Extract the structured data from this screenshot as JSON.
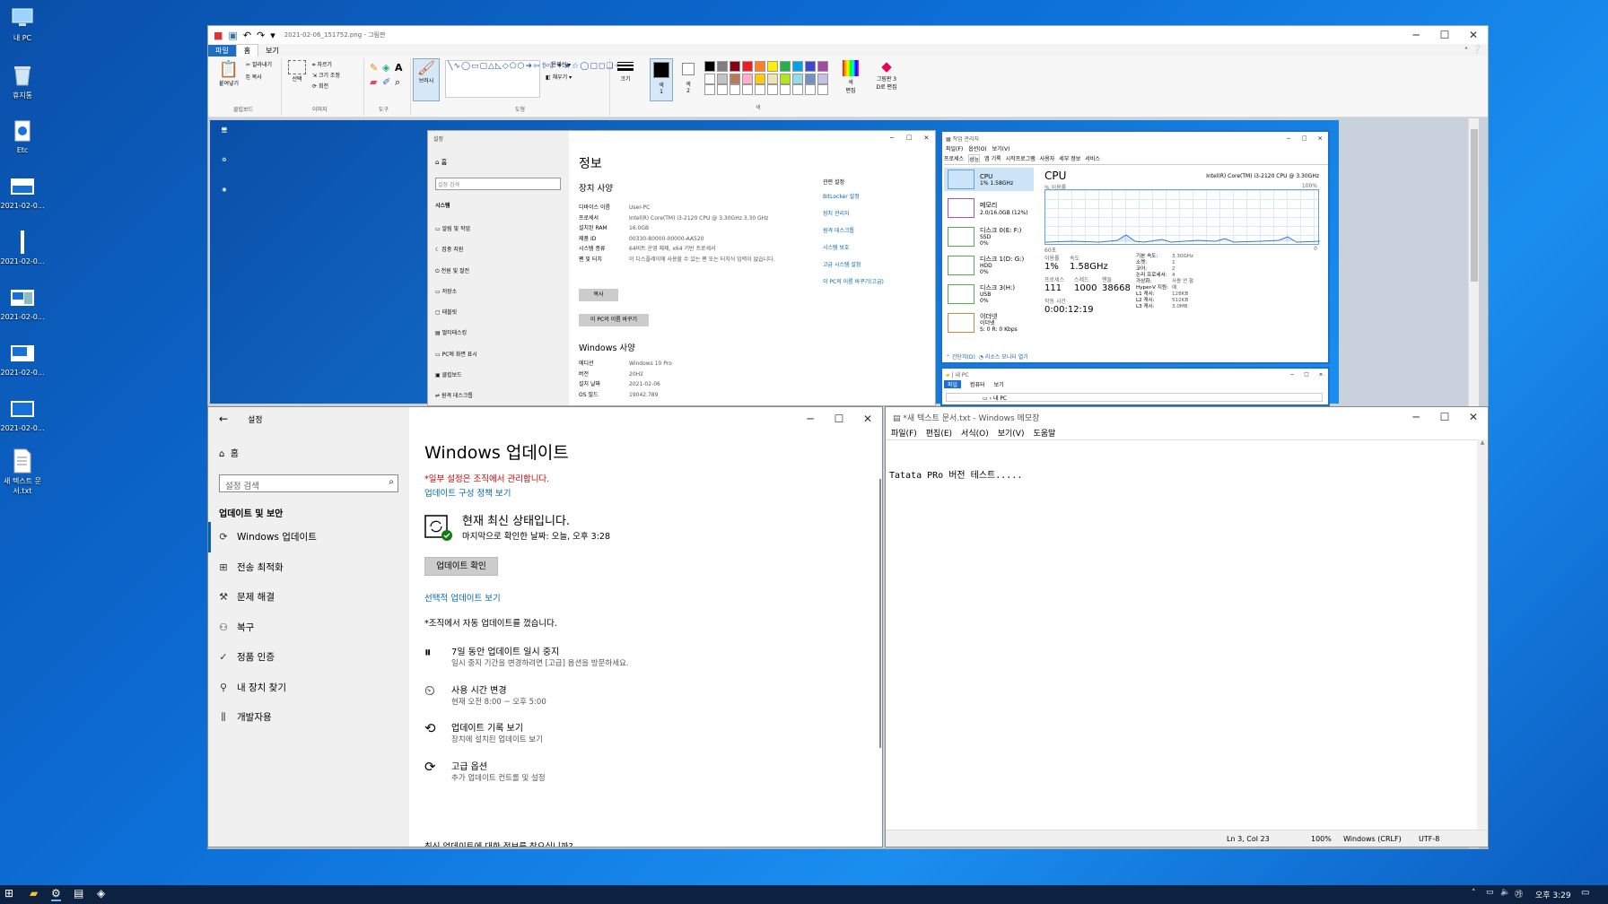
{
  "desktop": {
    "icons": [
      {
        "label": "내 PC",
        "icon": "computer-icon"
      },
      {
        "label": "휴지통",
        "icon": "recycle-bin-icon"
      },
      {
        "label": "Etc",
        "icon": "etc-icon"
      },
      {
        "label": "2021-02-0...",
        "icon": "image-file-icon"
      },
      {
        "label": "2021-02-0...",
        "icon": "image-file-icon"
      },
      {
        "label": "2021-02-0...",
        "icon": "image-file-icon"
      },
      {
        "label": "2021-02-0...",
        "icon": "image-file-icon"
      },
      {
        "label": "2021-02-0...",
        "icon": "image-file-icon"
      },
      {
        "label": "새 텍스트 문서.txt",
        "icon": "text-file-icon"
      }
    ]
  },
  "paint": {
    "title": "2021-02-06_151752.png - 그림판",
    "tabs": [
      "파일",
      "홈",
      "보기"
    ],
    "clipboard": {
      "paste": "붙여넣기",
      "cut": "잘라내기",
      "copy": "복사",
      "group": "클립보드"
    },
    "image": {
      "select": "선택",
      "crop": "자르기",
      "resize": "크기 조정",
      "rotate": "회전",
      "group": "이미지"
    },
    "tools": {
      "group": "도구",
      "brush": "브러시"
    },
    "shapes": {
      "outline": "윤곽선",
      "fill": "채우기",
      "group": "도형"
    },
    "size": "크기",
    "color1": "색\n1",
    "color2": "색\n2",
    "color_edit": "색\n편집",
    "paint3d": "그림판 3\nD로 편집",
    "colors_group": "색",
    "palette": [
      "#000000",
      "#7f7f7f",
      "#880015",
      "#ed1c24",
      "#ff7f27",
      "#fff200",
      "#22b14c",
      "#00a2e8",
      "#3f48cc",
      "#a349a4",
      "#ffffff",
      "#c3c3c3",
      "#b97a57",
      "#ffaec9",
      "#ffc90e",
      "#efe4b0",
      "#b5e61d",
      "#99d9ea",
      "#7092be",
      "#c8bfe7"
    ]
  },
  "inner_settings": {
    "title": "설정",
    "home": "홈",
    "search_placeholder": "설정 검색",
    "section": "시스템",
    "nav": [
      "알림 및 작업",
      "집중 지원",
      "전원 및 절전",
      "저장소",
      "태블릿",
      "멀티태스킹",
      "PC에 화면 표시",
      "클립보드",
      "원격 데스크톱"
    ],
    "page_title": "정보",
    "device_spec": "장치 사양",
    "rows": [
      {
        "k": "디바이스 이름",
        "v": "User-PC"
      },
      {
        "k": "프로세서",
        "v": "Intel(R) Core(TM) i3-2120 CPU @ 3.30GHz   3.30 GHz"
      },
      {
        "k": "설치된 RAM",
        "v": "16.0GB"
      },
      {
        "k": "제품 ID",
        "v": "00330-80000-00000-AA520"
      },
      {
        "k": "시스템 종류",
        "v": "64비트 운영 체제, x64 기반 프로세서"
      },
      {
        "k": "펜 및 터치",
        "v": "이 디스플레이에 사용할 수 있는 펜 또는 터치식 입력이 없습니다."
      }
    ],
    "copy_btn": "복사",
    "rename_btn": "이 PC의 이름 바꾸기",
    "win_spec": "Windows 사양",
    "win_rows": [
      {
        "k": "에디션",
        "v": "Windows 10 Pro"
      },
      {
        "k": "버전",
        "v": "20H2"
      },
      {
        "k": "설치 날짜",
        "v": "2021-02-06"
      },
      {
        "k": "OS 빌드",
        "v": "19042.789"
      }
    ],
    "related_title": "관련 설정",
    "related": [
      "BitLocker 설정",
      "장치 관리자",
      "원격 데스크톱",
      "시스템 보호",
      "고급 시스템 설정",
      "이 PC의 이름 바꾸기(고급)"
    ]
  },
  "taskmgr": {
    "title": "작업 관리자",
    "menu": [
      "파일(F)",
      "옵션(O)",
      "보기(V)"
    ],
    "tabs": [
      "프로세스",
      "성능",
      "앱 기록",
      "시작프로그램",
      "사용자",
      "세부 정보",
      "서비스"
    ],
    "side": [
      {
        "name": "CPU",
        "sub": "1% 1.58GHz"
      },
      {
        "name": "메모리",
        "sub": "2.0/16.0GB (12%)"
      },
      {
        "name": "디스크 0(E: F:)",
        "sub": "SSD\n0%"
      },
      {
        "name": "디스크 1(D: G:)",
        "sub": "HDD\n0%"
      },
      {
        "name": "디스크 3(H:)",
        "sub": "USB\n0%"
      },
      {
        "name": "이더넷",
        "sub": "이더넷\nS: 0 R: 0 Kbps"
      }
    ],
    "cpu_title": "CPU",
    "cpu_model": "Intel(R) Core(TM) i3-2120 CPU @ 3.30GHz",
    "usage_label": "% 이용률",
    "pct100": "100%",
    "secs": "60초",
    "zero": "0",
    "util_label": "이용률",
    "util": "1%",
    "speed_label": "속도",
    "speed": "1.58GHz",
    "proc_label": "프로세스",
    "proc": "111",
    "thread_label": "스레드",
    "thread": "1000",
    "handle_label": "핸들",
    "handle": "38668",
    "uptime_label": "작동 시간",
    "uptime": "0:00:12:19",
    "specs": [
      {
        "k": "기본 속도:",
        "v": "3.30GHz"
      },
      {
        "k": "소켓:",
        "v": "1"
      },
      {
        "k": "코어:",
        "v": "2"
      },
      {
        "k": "논리 프로세서:",
        "v": "4"
      },
      {
        "k": "가상화:",
        "v": "사용 안 함"
      },
      {
        "k": "Hyper-V 지원:",
        "v": "예"
      },
      {
        "k": "L1 캐시:",
        "v": "128KB"
      },
      {
        "k": "L2 캐시:",
        "v": "512KB"
      },
      {
        "k": "L3 캐시:",
        "v": "3.0MB"
      }
    ],
    "footer_brief": "간단히(D)",
    "footer_monitor": "리소스 모니터 열기"
  },
  "explorer": {
    "title": "내 PC",
    "tabs": [
      "파일",
      "컴퓨터",
      "보기"
    ],
    "path": "내 PC"
  },
  "winupdate": {
    "title": "설정",
    "home": "홈",
    "search_placeholder": "설정 검색",
    "section": "업데이트 및 보안",
    "nav": [
      {
        "label": "Windows 업데이트",
        "icon": "sync-icon"
      },
      {
        "label": "전송 최적화",
        "icon": "delivery-icon"
      },
      {
        "label": "문제 해결",
        "icon": "wrench-icon"
      },
      {
        "label": "복구",
        "icon": "recovery-icon"
      },
      {
        "label": "정품 인증",
        "icon": "check-circle-icon"
      },
      {
        "label": "내 장치 찾기",
        "icon": "find-device-icon"
      },
      {
        "label": "개발자용",
        "icon": "developer-icon"
      }
    ],
    "page_title": "Windows 업데이트",
    "managed": "*일부 설정은 조직에서 관리합니다.",
    "policy_link": "업데이트 구성 정책 보기",
    "status": "현재 최신 상태입니다.",
    "last_check": "마지막으로 확인한 날짜: 오늘, 오후 3:28",
    "check_btn": "업데이트 확인",
    "optional_link": "선택적 업데이트 보기",
    "org_off": "*조직에서 자동 업데이트를 껐습니다.",
    "options": [
      {
        "title": "7일 동안 업데이트 일시 중지",
        "sub": "일시 중지 기간을 변경하려면 [고급] 옵션을 방문하세요.",
        "icon": "pause-icon"
      },
      {
        "title": "사용 시간 변경",
        "sub": "현재 오전 8:00 ~ 오후 5:00",
        "icon": "clock-icon"
      },
      {
        "title": "업데이트 기록 보기",
        "sub": "장치에 설치된 업데이트 보기",
        "icon": "history-icon"
      },
      {
        "title": "고급 옵션",
        "sub": "추가 업데이트 컨트롤 및 설정",
        "icon": "advanced-sync-icon"
      }
    ],
    "bottom": "최신 업데이트에 대한 정보를 찾으십니까?"
  },
  "notepad": {
    "title": "*새 텍스트 문서.txt - Windows 메모장",
    "menu": [
      "파일(F)",
      "편집(E)",
      "서식(O)",
      "보기(V)",
      "도움말"
    ],
    "content": "Tatata PRo 버전 테스트.....",
    "status": {
      "pos": "Ln 3, Col 23",
      "zoom": "100%",
      "eol": "Windows (CRLF)",
      "enc": "UTF-8"
    }
  },
  "taskbar": {
    "clock": "오후 3:29"
  }
}
